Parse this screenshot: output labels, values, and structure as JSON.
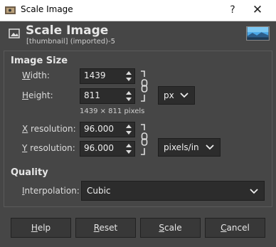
{
  "window": {
    "title": "Scale Image",
    "help_glyph": "?",
    "close_glyph": "✕"
  },
  "header": {
    "title": "Scale Image",
    "subtitle": "[thumbnail] (imported)-5"
  },
  "image_size": {
    "section_label": "Image Size",
    "width_label_key": "W",
    "width_label_rest": "idth:",
    "width_value": "1439",
    "height_label_key": "H",
    "height_label_rest": "eight:",
    "height_value": "811",
    "size_unit": "px",
    "size_note": "1439 × 811 pixels",
    "xres_label_key": "X",
    "xres_label_rest": " resolution:",
    "xres_value": "96.000",
    "yres_label_key": "Y",
    "yres_label_rest": " resolution:",
    "yres_value": "96.000",
    "res_unit": "pixels/in"
  },
  "quality": {
    "section_label": "Quality",
    "interp_label_key": "I",
    "interp_label_rest": "nterpolation:",
    "interpolation_value": "Cubic"
  },
  "buttons": {
    "help_key": "H",
    "help_rest": "elp",
    "reset_key": "R",
    "reset_rest": "eset",
    "scale_key": "S",
    "scale_rest": "cale",
    "cancel_key": "C",
    "cancel_rest": "ancel"
  },
  "icons": {
    "app": "gimp-icon",
    "image": "image-icon",
    "chain": "chain-link-icon",
    "dropdown": "chevron-down-icon"
  }
}
